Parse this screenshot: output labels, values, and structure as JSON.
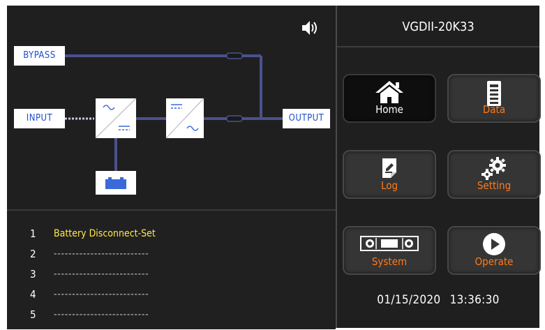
{
  "mimic": {
    "bypass_label": "BYPASS",
    "input_label": "INPUT",
    "output_label": "OUTPUT",
    "speaker_icon": "speaker-icon"
  },
  "log": {
    "rows": [
      {
        "num": "1",
        "text": "Battery Disconnect-Set"
      },
      {
        "num": "2",
        "text": "--------------------------"
      },
      {
        "num": "3",
        "text": "--------------------------"
      },
      {
        "num": "4",
        "text": "--------------------------"
      },
      {
        "num": "5",
        "text": "--------------------------"
      }
    ]
  },
  "header": {
    "model": "VGDII-20K33"
  },
  "menu": {
    "home": {
      "label": "Home",
      "icon": "home-icon"
    },
    "data": {
      "label": "Data",
      "icon": "battery-data-icon"
    },
    "log": {
      "label": "Log",
      "icon": "edit-log-icon"
    },
    "setting": {
      "label": "Setting",
      "icon": "gears-icon"
    },
    "system": {
      "label": "System",
      "icon": "system-icon"
    },
    "operate": {
      "label": "Operate",
      "icon": "play-icon"
    }
  },
  "status": {
    "date": "01/15/2020",
    "time": "13:36:30"
  },
  "colors": {
    "line": "#4a5190",
    "accent_orange": "#ff7a1a",
    "log_highlight": "#ffe94a",
    "label_blue": "#1f4fd0"
  }
}
